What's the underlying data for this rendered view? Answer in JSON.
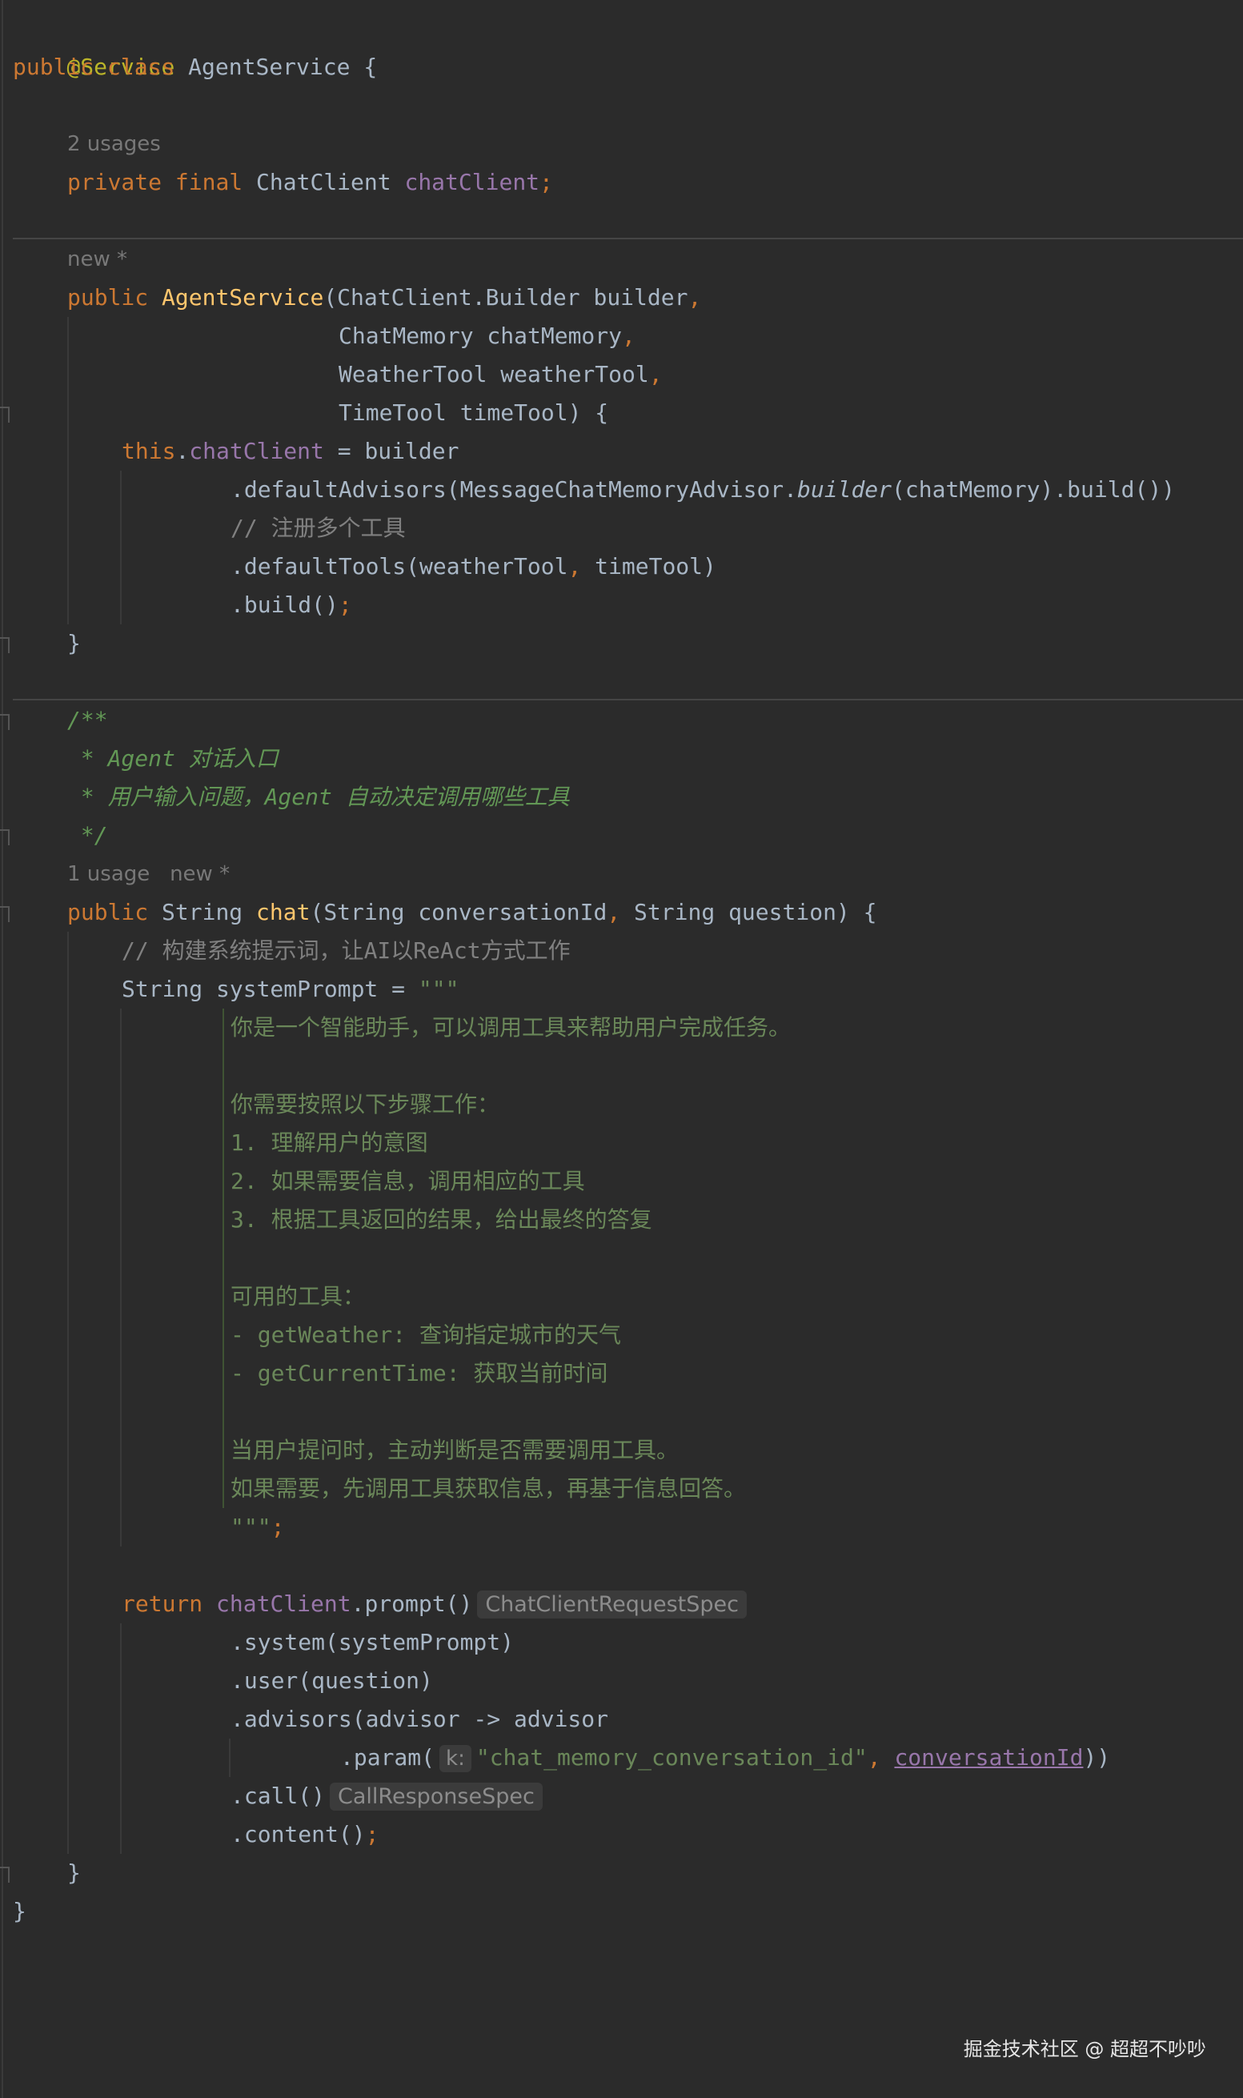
{
  "code": {
    "ann_service": "@Service",
    "kw_public": "public",
    "kw_class": "class",
    "class_name": "AgentService",
    "brace_open": "{",
    "brace_close": "}",
    "usages_2": "2 usages",
    "kw_private": "private",
    "kw_final": "final",
    "type_chatclient": "ChatClient",
    "field_chatclient": "chatClient",
    "semicolon": ";",
    "new_marker": "new *",
    "ctor_name": "AgentService",
    "ctor_param1": "(ChatClient.Builder builder",
    "comma": ",",
    "ctor_param2": "ChatMemory chatMemory",
    "ctor_param3": "WeatherTool weatherTool",
    "ctor_param4": "TimeTool timeTool) {",
    "kw_this": "this",
    "dot": ".",
    "assign_builder": " = builder",
    "default_advisors_a": ".defaultAdvisors(MessageChatMemoryAdvisor.",
    "builder_italic": "builder",
    "default_advisors_b": "(chatMemory).build())",
    "comment_register": "// 注册多个工具",
    "default_tools_a": ".defaultTools(weatherTool",
    "default_tools_b": " timeTool)",
    "build_call": ".build()",
    "doc_open": "/**",
    "doc_line1": " * Agent 对话入口",
    "doc_line2": " * 用户输入问题，Agent 自动决定调用哪些工具",
    "doc_close": " */",
    "usage_1": "1 usage",
    "new_marker2": "new *",
    "type_string": "String",
    "method_chat": "chat",
    "chat_params_a": "(String conversationId",
    "chat_params_b": " String question) {",
    "comment_system": "// 构建系统提示词，让AI以ReAct方式工作",
    "system_prompt_decl": "String systemPrompt = ",
    "triple_quote": "\"\"\"",
    "prompt_line1": "你是一个智能助手，可以调用工具来帮助用户完成任务。",
    "prompt_line2": "你需要按照以下步骤工作：",
    "prompt_line3": "1. 理解用户的意图",
    "prompt_line4": "2. 如果需要信息，调用相应的工具",
    "prompt_line5": "3. 根据工具返回的结果，给出最终的答复",
    "prompt_line6": "可用的工具：",
    "prompt_line7": "- getWeather: 查询指定城市的天气",
    "prompt_line8": "- getCurrentTime: 获取当前时间",
    "prompt_line9": "当用户提问时，主动判断是否需要调用工具。",
    "prompt_line10": "如果需要，先调用工具获取信息，再基于信息回答。",
    "kw_return": "return",
    "prompt_call": ".prompt()",
    "hint_request_spec": "ChatClientRequestSpec",
    "system_call": ".system(systemPrompt)",
    "user_call": ".user(question)",
    "advisors_call": ".advisors(advisor -> advisor",
    "param_call_a": ".param(",
    "param_hint_k": "k:",
    "param_string": "\"chat_memory_conversation_id\"",
    "param_link": "conversationId",
    "param_close": "))",
    "call_call": ".call()",
    "hint_response_spec": "CallResponseSpec",
    "content_call": ".content()"
  },
  "watermark": "掘金技术社区 @ 超超不吵吵",
  "colors": {
    "background": "#2b2b2b",
    "keyword": "#cc7832",
    "annotation": "#bbb529",
    "field": "#9876aa",
    "function": "#ffc66d",
    "string": "#6a8759",
    "comment": "#808080",
    "doc_comment": "#629755",
    "default_text": "#a9b7c6"
  }
}
